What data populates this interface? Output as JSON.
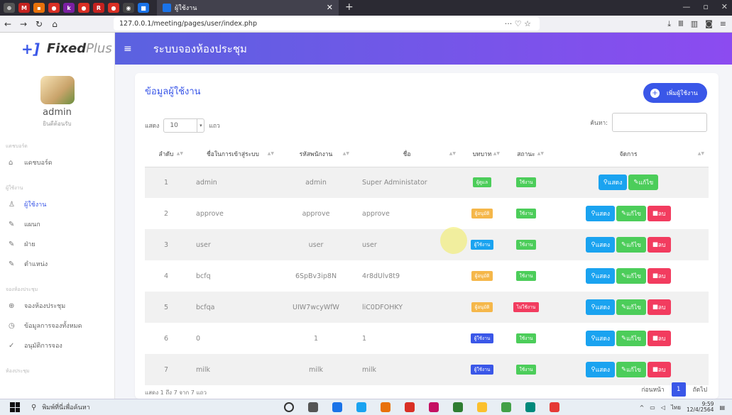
{
  "browser": {
    "active_tab_title": "ผู้ใช้งาน",
    "url_prefix": "127.0.0.1",
    "url_path": "/meeting/pages/user/index.php"
  },
  "brand": {
    "mark": "+]",
    "name_bold": "Fixed",
    "name_light": "Plus"
  },
  "user": {
    "name": "admin",
    "welcome": "ยินดีต้อนรับ"
  },
  "sidebar": {
    "sections": [
      {
        "title": "แดชบอร์ด",
        "items": [
          {
            "label": "แดชบอร์ด",
            "icon": "home-icon",
            "glyph": "⌂"
          }
        ]
      },
      {
        "title": "ผู้ใช้งาน",
        "items": [
          {
            "label": "ผู้ใช้งาน",
            "icon": "user-icon",
            "glyph": "♙",
            "active": true
          },
          {
            "label": "แผนก",
            "icon": "pencil-icon",
            "glyph": "✎"
          },
          {
            "label": "ฝ่าย",
            "icon": "pencil-icon",
            "glyph": "✎"
          },
          {
            "label": "ตำแหน่ง",
            "icon": "pencil-icon",
            "glyph": "✎"
          }
        ]
      },
      {
        "title": "จองห้องประชุม",
        "items": [
          {
            "label": "จองห้องประชุม",
            "icon": "plus-circle-icon",
            "glyph": "⊕"
          },
          {
            "label": "ข้อมูลการจองทั้งหมด",
            "icon": "clock-icon",
            "glyph": "◷"
          },
          {
            "label": "อนุมัติการจอง",
            "icon": "check-circle-icon",
            "glyph": "✓"
          }
        ]
      },
      {
        "title": "ห้องประชุม",
        "items": []
      }
    ]
  },
  "header": {
    "title": "ระบบจองห้องประชุม"
  },
  "card": {
    "title": "ข้อมูลผู้ใช้งาน",
    "add_button": "เพิ่มผู้ใช้งาน",
    "show_label": "แสดง",
    "page_length": "10",
    "rows_label": "แถว",
    "search_label": "ค้นหา:",
    "columns": [
      "ลำดับ",
      "ชื่อในการเข้าสู่ระบบ",
      "รหัสพนักงาน",
      "ชื่อ",
      "บทบาท",
      "สถานะ",
      "จัดการ"
    ],
    "rows": [
      {
        "no": "1",
        "login": "admin",
        "emp_id": "admin",
        "name": "Super Administator",
        "role": "ผู้ดูแล",
        "role_color": "#4ccd5a",
        "status": "ใช้งาน",
        "status_color": "#4ccd5a",
        "actions": [
          "show",
          "edit"
        ]
      },
      {
        "no": "2",
        "login": "approve",
        "emp_id": "approve",
        "name": "approve",
        "role": "ผู้อนุมัติ",
        "role_color": "#f5b74a",
        "status": "ใช้งาน",
        "status_color": "#4ccd5a",
        "actions": [
          "show",
          "edit",
          "delete"
        ]
      },
      {
        "no": "3",
        "login": "user",
        "emp_id": "user",
        "name": "user",
        "role": "ผู้ใช้งาน",
        "role_color": "#1aa3f0",
        "status": "ใช้งาน",
        "status_color": "#4ccd5a",
        "actions": [
          "show",
          "edit",
          "delete"
        ]
      },
      {
        "no": "4",
        "login": "bcfq",
        "emp_id": "6SpBv3ip8N",
        "name": "4r8dUlv8t9",
        "role": "ผู้อนุมัติ",
        "role_color": "#f5b74a",
        "status": "ใช้งาน",
        "status_color": "#4ccd5a",
        "actions": [
          "show",
          "edit",
          "delete"
        ]
      },
      {
        "no": "5",
        "login": "bcfqa",
        "emp_id": "UIW7wcyWfW",
        "name": "liC0DFOHKY",
        "role": "ผู้อนุมัติ",
        "role_color": "#f5b74a",
        "status": "ไม่ใช้งาน",
        "status_color": "#f23c5f",
        "actions": [
          "show",
          "edit",
          "delete"
        ]
      },
      {
        "no": "6",
        "login": "0",
        "emp_id": "1",
        "name": "1",
        "role": "ผู้ใช้งาน",
        "role_color": "#3a57e8",
        "status": "ใช้งาน",
        "status_color": "#4ccd5a",
        "actions": [
          "show",
          "edit",
          "delete"
        ]
      },
      {
        "no": "7",
        "login": "milk",
        "emp_id": "milk",
        "name": "milk",
        "role": "ผู้ใช้งาน",
        "role_color": "#3a57e8",
        "status": "ใช้งาน",
        "status_color": "#4ccd5a",
        "actions": [
          "show",
          "edit",
          "delete"
        ]
      }
    ],
    "action_labels": {
      "show": "แสดง",
      "edit": "แก้ไข",
      "delete": "ลบ"
    },
    "info": "แสดง 1 ถึง 7 จาก 7 แถว",
    "pager": {
      "prev": "ก่อนหน้า",
      "current": "1",
      "next": "ถัดไป"
    }
  },
  "taskbar": {
    "search_placeholder": "พิมพ์ที่นี่เพื่อค้นหา",
    "time": "9:59",
    "date": "12/4/2564",
    "lang": "ไทย"
  },
  "colors": {
    "accent": "#3a57e8",
    "header_start": "#5a62e0",
    "header_end": "#8c4bf0"
  }
}
